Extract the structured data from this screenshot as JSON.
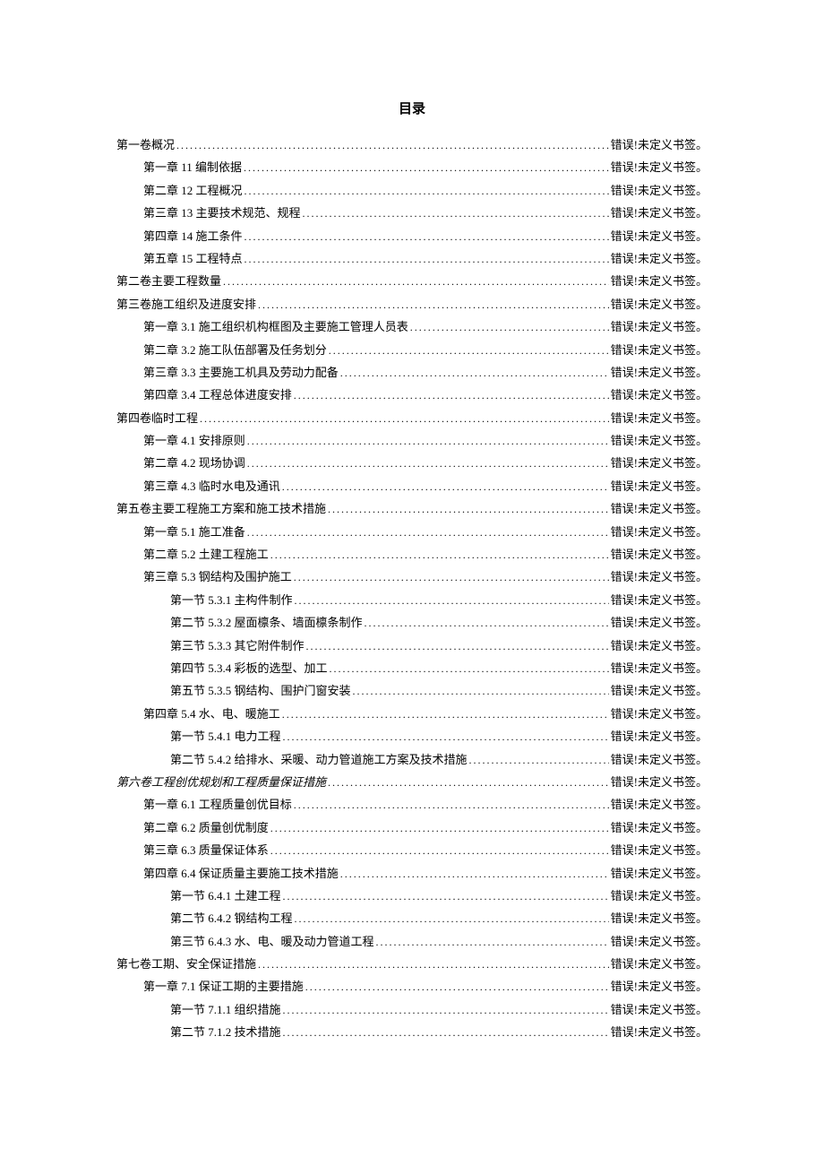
{
  "title": "目录",
  "error_text": "错误!未定义书签。",
  "entries": [
    {
      "level": 0,
      "text": "第一卷概况",
      "italic": false
    },
    {
      "level": 1,
      "text": "第一章 11 编制依据",
      "italic": false
    },
    {
      "level": 1,
      "text": "第二章 12 工程概况",
      "italic": false
    },
    {
      "level": 1,
      "text": "第三章 13 主要技术规范、规程",
      "italic": false
    },
    {
      "level": 1,
      "text": "第四章 14 施工条件",
      "italic": false
    },
    {
      "level": 1,
      "text": "第五章 15 工程特点",
      "italic": false
    },
    {
      "level": 0,
      "text": "第二卷主要工程数量",
      "italic": false
    },
    {
      "level": 0,
      "text": "第三卷施工组织及进度安排",
      "italic": false
    },
    {
      "level": 1,
      "text": "第一章 3.1 施工组织机构框图及主要施工管理人员表",
      "italic": false
    },
    {
      "level": 1,
      "text": "第二章 3.2 施工队伍部署及任务划分",
      "italic": false
    },
    {
      "level": 1,
      "text": "第三章 3.3 主要施工机具及劳动力配备",
      "italic": false
    },
    {
      "level": 1,
      "text": "第四章 3.4 工程总体进度安排",
      "italic": false
    },
    {
      "level": 0,
      "text": "第四卷临时工程",
      "italic": false
    },
    {
      "level": 1,
      "text": "第一章 4.1 安排原则",
      "italic": false
    },
    {
      "level": 1,
      "text": "第二章 4.2 现场协调",
      "italic": false
    },
    {
      "level": 1,
      "text": "第三章 4.3 临时水电及通讯",
      "italic": false
    },
    {
      "level": 0,
      "text": "第五卷主要工程施工方案和施工技术措施",
      "italic": false
    },
    {
      "level": 1,
      "text": "第一章 5.1 施工准备",
      "italic": false
    },
    {
      "level": 1,
      "text": "第二章 5.2 土建工程施工",
      "italic": false
    },
    {
      "level": 1,
      "text": "第三章 5.3 钢结构及围护施工",
      "italic": false
    },
    {
      "level": 2,
      "text": "第一节 5.3.1 主构件制作",
      "italic": false
    },
    {
      "level": 2,
      "text": "第二节 5.3.2 屋面檩条、墙面檩条制作",
      "italic": false
    },
    {
      "level": 2,
      "text": "第三节 5.3.3 其它附件制作",
      "italic": false
    },
    {
      "level": 2,
      "text": "第四节 5.3.4 彩板的选型、加工",
      "italic": false
    },
    {
      "level": 2,
      "text": "第五节 5.3.5 钢结构、围护门窗安装",
      "italic": false
    },
    {
      "level": 1,
      "text": "第四章 5.4 水、电、暖施工",
      "italic": false
    },
    {
      "level": 2,
      "text": "第一节 5.4.1 电力工程",
      "italic": false
    },
    {
      "level": 2,
      "text": "第二节 5.4.2 给排水、采暖、动力管道施工方案及技术措施",
      "italic": false
    },
    {
      "level": 0,
      "text": "第六卷工程创优规划和工程质量保证措施",
      "italic": true
    },
    {
      "level": 1,
      "text": "第一章 6.1 工程质量创优目标",
      "italic": false
    },
    {
      "level": 1,
      "text": "第二章 6.2 质量创优制度",
      "italic": false
    },
    {
      "level": 1,
      "text": "第三章 6.3 质量保证体系",
      "italic": false
    },
    {
      "level": 1,
      "text": "第四章 6.4 保证质量主要施工技术措施",
      "italic": false
    },
    {
      "level": 2,
      "text": "第一节 6.4.1 土建工程",
      "italic": false
    },
    {
      "level": 2,
      "text": "第二节 6.4.2 钢结构工程",
      "italic": false
    },
    {
      "level": 2,
      "text": "第三节 6.4.3 水、电、暖及动力管道工程",
      "italic": false
    },
    {
      "level": 0,
      "text": "第七卷工期、安全保证措施",
      "italic": false
    },
    {
      "level": 1,
      "text": "第一章 7.1 保证工期的主要措施",
      "italic": false
    },
    {
      "level": 2,
      "text": "第一节 7.1.1 组织措施",
      "italic": false
    },
    {
      "level": 2,
      "text": "第二节 7.1.2 技术措施",
      "italic": false
    }
  ]
}
